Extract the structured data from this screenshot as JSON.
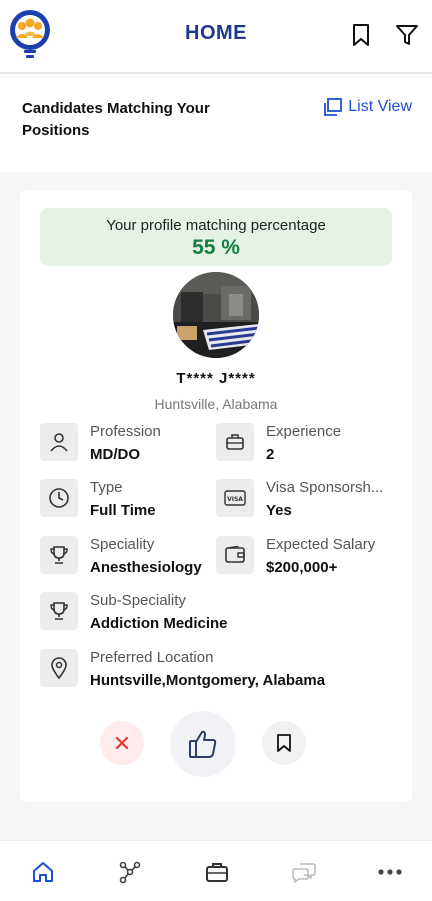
{
  "header": {
    "title": "HOME",
    "logo_icon": "people-lightbulb-logo",
    "bookmark_icon": "bookmark-icon",
    "filter_icon": "filter-icon"
  },
  "subheader": {
    "title": "Candidates Matching Your Positions",
    "list_view_label": "List View",
    "list_view_icon": "list-view-icon"
  },
  "card": {
    "match_label": "Your profile matching percentage",
    "match_value": "55 %",
    "candidate_name": "T**** J****",
    "candidate_location": "Huntsville, Alabama",
    "fields": {
      "profession": {
        "label": "Profession",
        "value": "MD/DO",
        "icon": "user-icon"
      },
      "experience": {
        "label": "Experience",
        "value": "2",
        "icon": "briefcase-icon"
      },
      "type": {
        "label": "Type",
        "value": "Full Time",
        "icon": "clock-icon"
      },
      "visa": {
        "label": "Visa Sponsorsh...",
        "value": "Yes",
        "icon": "visa-card-icon"
      },
      "speciality": {
        "label": "Speciality",
        "value": "Anesthesiology",
        "icon": "trophy-icon"
      },
      "salary": {
        "label": "Expected Salary",
        "value": "$200,000+",
        "icon": "wallet-icon"
      },
      "sub_speciality": {
        "label": "Sub-Speciality",
        "value": "Addiction Medicine",
        "icon": "trophy-icon"
      },
      "preferred_location": {
        "label": "Preferred Location",
        "value": "Huntsville,Montgomery, Alabama",
        "icon": "location-pin-icon"
      }
    },
    "actions": {
      "reject_icon": "close-icon",
      "like_icon": "thumbs-up-icon",
      "save_icon": "bookmark-icon"
    }
  },
  "bottom_nav": {
    "items": [
      {
        "icon": "home-icon",
        "active": true
      },
      {
        "icon": "network-icon",
        "active": false
      },
      {
        "icon": "briefcase-icon",
        "active": false
      },
      {
        "icon": "chat-icon",
        "active": false
      },
      {
        "icon": "more-icon",
        "active": false
      }
    ]
  },
  "colors": {
    "brand_blue": "#1e3a8a",
    "link_blue": "#1d4ed8",
    "match_green": "#15803d",
    "match_bg": "#e6f2e6",
    "reject_red": "#e53935"
  }
}
